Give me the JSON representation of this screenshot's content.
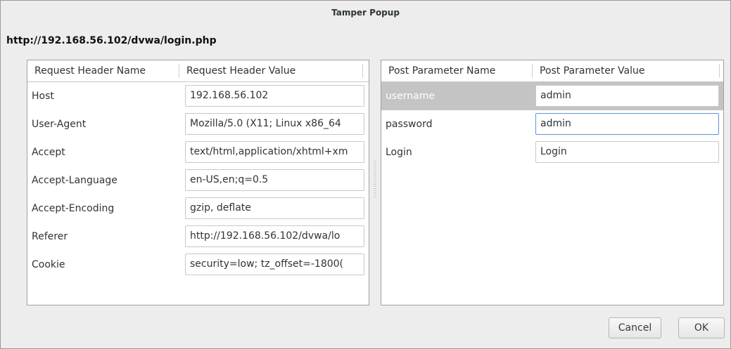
{
  "window": {
    "title": "Tamper Popup",
    "url": "http://192.168.56.102/dvwa/login.php"
  },
  "request_headers": {
    "columns": [
      "Request Header Name",
      "Request Header Value"
    ],
    "rows": [
      {
        "name": "Host",
        "value": "192.168.56.102"
      },
      {
        "name": "User-Agent",
        "value": "Mozilla/5.0 (X11; Linux x86_64"
      },
      {
        "name": "Accept",
        "value": "text/html,application/xhtml+xm"
      },
      {
        "name": "Accept-Language",
        "value": "en-US,en;q=0.5"
      },
      {
        "name": "Accept-Encoding",
        "value": "gzip, deflate"
      },
      {
        "name": "Referer",
        "value": "http://192.168.56.102/dvwa/lo"
      },
      {
        "name": "Cookie",
        "value": "security=low; tz_offset=-1800("
      }
    ]
  },
  "post_parameters": {
    "columns": [
      "Post Parameter Name",
      "Post Parameter Value"
    ],
    "rows": [
      {
        "name": "username",
        "value": "admin",
        "selected": true
      },
      {
        "name": "password",
        "value": "admin",
        "focused": true
      },
      {
        "name": "Login",
        "value": "Login"
      }
    ]
  },
  "buttons": {
    "cancel": "Cancel",
    "ok": "OK"
  }
}
